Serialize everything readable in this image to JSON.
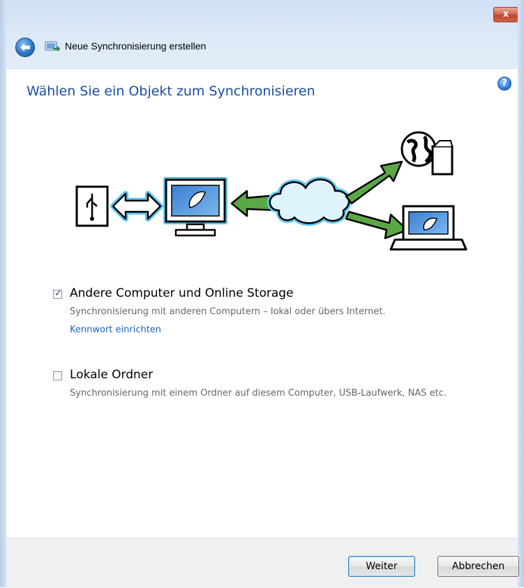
{
  "window": {
    "title": "Neue Synchronisierung erstellen",
    "close_glyph": "x"
  },
  "content": {
    "heading": "Wählen Sie ein Objekt zum Synchronisieren",
    "help_glyph": "?"
  },
  "options": {
    "online": {
      "label": "Andere Computer und Online Storage",
      "description": "Synchronisierung mit anderen Computern – lokal oder übers Internet.",
      "link": "Kennwort einrichten",
      "checked": true
    },
    "local": {
      "label": "Lokale Ordner",
      "description": "Synchronisierung mit einem Ordner auf diesem Computer, USB-Laufwerk, NAS etc.",
      "checked": false
    }
  },
  "buttons": {
    "next": "Weiter",
    "cancel": "Abbrechen"
  },
  "icons": {
    "back": "back-arrow-icon",
    "app": "sync-app-icon",
    "help": "help-icon",
    "close": "close-icon"
  },
  "colors": {
    "heading": "#1b4ea3",
    "link": "#1d64bd",
    "arrow_green": "#5aa845",
    "glow_blue": "#5fc7f0"
  }
}
